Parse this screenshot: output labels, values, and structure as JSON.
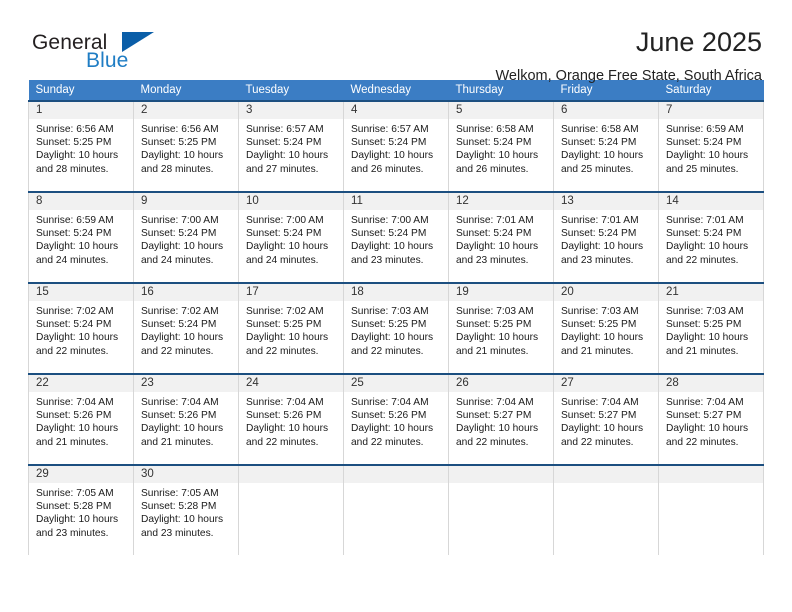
{
  "logo": {
    "word_top": "General",
    "word_bottom": "Blue",
    "triangle_icon": "blue-triangle-icon",
    "color_dark": "#231f20",
    "color_blue": "#1f7dc4",
    "color_triangle": "#0a5ea8"
  },
  "header": {
    "title": "June 2025",
    "subtitle": "Welkom, Orange Free State, South Africa"
  },
  "theme": {
    "header_bg": "#3b7dc4",
    "row_top_border": "#1c4f80",
    "daynum_bg": "#f1f1f1",
    "cell_border": "#d7d7d7"
  },
  "weekdays": [
    "Sunday",
    "Monday",
    "Tuesday",
    "Wednesday",
    "Thursday",
    "Friday",
    "Saturday"
  ],
  "labels": {
    "sunrise_prefix": "Sunrise:",
    "sunset_prefix": "Sunset:",
    "daylight_prefix": "Daylight:"
  },
  "weeks": [
    [
      {
        "day": "1",
        "sunrise": "Sunrise: 6:56 AM",
        "sunset": "Sunset: 5:25 PM",
        "daylight1": "Daylight: 10 hours",
        "daylight2": "and 28 minutes."
      },
      {
        "day": "2",
        "sunrise": "Sunrise: 6:56 AM",
        "sunset": "Sunset: 5:25 PM",
        "daylight1": "Daylight: 10 hours",
        "daylight2": "and 28 minutes."
      },
      {
        "day": "3",
        "sunrise": "Sunrise: 6:57 AM",
        "sunset": "Sunset: 5:24 PM",
        "daylight1": "Daylight: 10 hours",
        "daylight2": "and 27 minutes."
      },
      {
        "day": "4",
        "sunrise": "Sunrise: 6:57 AM",
        "sunset": "Sunset: 5:24 PM",
        "daylight1": "Daylight: 10 hours",
        "daylight2": "and 26 minutes."
      },
      {
        "day": "5",
        "sunrise": "Sunrise: 6:58 AM",
        "sunset": "Sunset: 5:24 PM",
        "daylight1": "Daylight: 10 hours",
        "daylight2": "and 26 minutes."
      },
      {
        "day": "6",
        "sunrise": "Sunrise: 6:58 AM",
        "sunset": "Sunset: 5:24 PM",
        "daylight1": "Daylight: 10 hours",
        "daylight2": "and 25 minutes."
      },
      {
        "day": "7",
        "sunrise": "Sunrise: 6:59 AM",
        "sunset": "Sunset: 5:24 PM",
        "daylight1": "Daylight: 10 hours",
        "daylight2": "and 25 minutes."
      }
    ],
    [
      {
        "day": "8",
        "sunrise": "Sunrise: 6:59 AM",
        "sunset": "Sunset: 5:24 PM",
        "daylight1": "Daylight: 10 hours",
        "daylight2": "and 24 minutes."
      },
      {
        "day": "9",
        "sunrise": "Sunrise: 7:00 AM",
        "sunset": "Sunset: 5:24 PM",
        "daylight1": "Daylight: 10 hours",
        "daylight2": "and 24 minutes."
      },
      {
        "day": "10",
        "sunrise": "Sunrise: 7:00 AM",
        "sunset": "Sunset: 5:24 PM",
        "daylight1": "Daylight: 10 hours",
        "daylight2": "and 24 minutes."
      },
      {
        "day": "11",
        "sunrise": "Sunrise: 7:00 AM",
        "sunset": "Sunset: 5:24 PM",
        "daylight1": "Daylight: 10 hours",
        "daylight2": "and 23 minutes."
      },
      {
        "day": "12",
        "sunrise": "Sunrise: 7:01 AM",
        "sunset": "Sunset: 5:24 PM",
        "daylight1": "Daylight: 10 hours",
        "daylight2": "and 23 minutes."
      },
      {
        "day": "13",
        "sunrise": "Sunrise: 7:01 AM",
        "sunset": "Sunset: 5:24 PM",
        "daylight1": "Daylight: 10 hours",
        "daylight2": "and 23 minutes."
      },
      {
        "day": "14",
        "sunrise": "Sunrise: 7:01 AM",
        "sunset": "Sunset: 5:24 PM",
        "daylight1": "Daylight: 10 hours",
        "daylight2": "and 22 minutes."
      }
    ],
    [
      {
        "day": "15",
        "sunrise": "Sunrise: 7:02 AM",
        "sunset": "Sunset: 5:24 PM",
        "daylight1": "Daylight: 10 hours",
        "daylight2": "and 22 minutes."
      },
      {
        "day": "16",
        "sunrise": "Sunrise: 7:02 AM",
        "sunset": "Sunset: 5:24 PM",
        "daylight1": "Daylight: 10 hours",
        "daylight2": "and 22 minutes."
      },
      {
        "day": "17",
        "sunrise": "Sunrise: 7:02 AM",
        "sunset": "Sunset: 5:25 PM",
        "daylight1": "Daylight: 10 hours",
        "daylight2": "and 22 minutes."
      },
      {
        "day": "18",
        "sunrise": "Sunrise: 7:03 AM",
        "sunset": "Sunset: 5:25 PM",
        "daylight1": "Daylight: 10 hours",
        "daylight2": "and 22 minutes."
      },
      {
        "day": "19",
        "sunrise": "Sunrise: 7:03 AM",
        "sunset": "Sunset: 5:25 PM",
        "daylight1": "Daylight: 10 hours",
        "daylight2": "and 21 minutes."
      },
      {
        "day": "20",
        "sunrise": "Sunrise: 7:03 AM",
        "sunset": "Sunset: 5:25 PM",
        "daylight1": "Daylight: 10 hours",
        "daylight2": "and 21 minutes."
      },
      {
        "day": "21",
        "sunrise": "Sunrise: 7:03 AM",
        "sunset": "Sunset: 5:25 PM",
        "daylight1": "Daylight: 10 hours",
        "daylight2": "and 21 minutes."
      }
    ],
    [
      {
        "day": "22",
        "sunrise": "Sunrise: 7:04 AM",
        "sunset": "Sunset: 5:26 PM",
        "daylight1": "Daylight: 10 hours",
        "daylight2": "and 21 minutes."
      },
      {
        "day": "23",
        "sunrise": "Sunrise: 7:04 AM",
        "sunset": "Sunset: 5:26 PM",
        "daylight1": "Daylight: 10 hours",
        "daylight2": "and 21 minutes."
      },
      {
        "day": "24",
        "sunrise": "Sunrise: 7:04 AM",
        "sunset": "Sunset: 5:26 PM",
        "daylight1": "Daylight: 10 hours",
        "daylight2": "and 22 minutes."
      },
      {
        "day": "25",
        "sunrise": "Sunrise: 7:04 AM",
        "sunset": "Sunset: 5:26 PM",
        "daylight1": "Daylight: 10 hours",
        "daylight2": "and 22 minutes."
      },
      {
        "day": "26",
        "sunrise": "Sunrise: 7:04 AM",
        "sunset": "Sunset: 5:27 PM",
        "daylight1": "Daylight: 10 hours",
        "daylight2": "and 22 minutes."
      },
      {
        "day": "27",
        "sunrise": "Sunrise: 7:04 AM",
        "sunset": "Sunset: 5:27 PM",
        "daylight1": "Daylight: 10 hours",
        "daylight2": "and 22 minutes."
      },
      {
        "day": "28",
        "sunrise": "Sunrise: 7:04 AM",
        "sunset": "Sunset: 5:27 PM",
        "daylight1": "Daylight: 10 hours",
        "daylight2": "and 22 minutes."
      }
    ],
    [
      {
        "day": "29",
        "sunrise": "Sunrise: 7:05 AM",
        "sunset": "Sunset: 5:28 PM",
        "daylight1": "Daylight: 10 hours",
        "daylight2": "and 23 minutes."
      },
      {
        "day": "30",
        "sunrise": "Sunrise: 7:05 AM",
        "sunset": "Sunset: 5:28 PM",
        "daylight1": "Daylight: 10 hours",
        "daylight2": "and 23 minutes."
      },
      {
        "day": "",
        "sunrise": "",
        "sunset": "",
        "daylight1": "",
        "daylight2": ""
      },
      {
        "day": "",
        "sunrise": "",
        "sunset": "",
        "daylight1": "",
        "daylight2": ""
      },
      {
        "day": "",
        "sunrise": "",
        "sunset": "",
        "daylight1": "",
        "daylight2": ""
      },
      {
        "day": "",
        "sunrise": "",
        "sunset": "",
        "daylight1": "",
        "daylight2": ""
      },
      {
        "day": "",
        "sunrise": "",
        "sunset": "",
        "daylight1": "",
        "daylight2": ""
      }
    ]
  ]
}
